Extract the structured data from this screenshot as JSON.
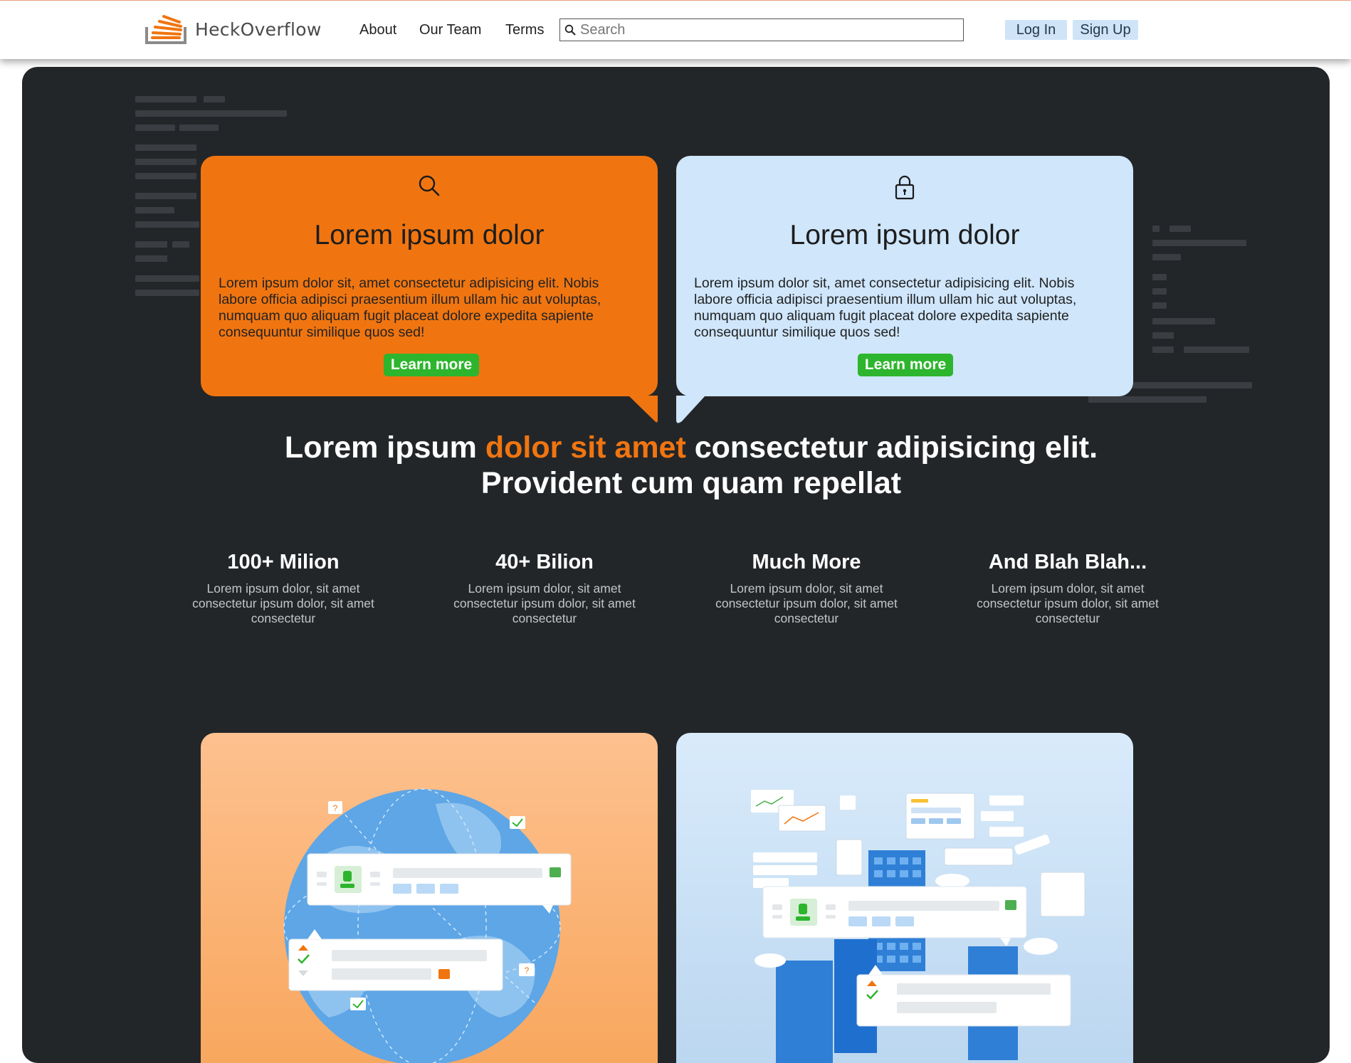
{
  "header": {
    "logo_text": "HeckOverflow",
    "nav": [
      "About",
      "Our Team",
      "Terms"
    ],
    "search": {
      "placeholder": "Search",
      "value": ""
    },
    "login_label": "Log In",
    "signup_label": "Sign Up"
  },
  "cards": [
    {
      "icon": "search-icon",
      "title": "Lorem ipsum dolor",
      "text": "Lorem ipsum dolor sit, amet consectetur adipisicing elit. Nobis labore officia adipisci praesentium illum ullam hic aut voluptas, numquam quo aliquam fugit placeat dolore expedita sapiente consequuntur similique quos sed!",
      "button": "Learn more"
    },
    {
      "icon": "lock-icon",
      "title": "Lorem ipsum dolor",
      "text": "Lorem ipsum dolor sit, amet consectetur adipisicing elit. Nobis labore officia adipisci praesentium illum ullam hic aut voluptas, numquam quo aliquam fugit placeat dolore expedita sapiente consequuntur similique quos sed!",
      "button": "Learn more"
    }
  ],
  "headline": {
    "part1": "Lorem ipsum ",
    "accent": "dolor sit amet",
    "part2": " consectetur adipisicing elit. Provident cum quam repellat"
  },
  "stats": [
    {
      "title": "100+ Milion",
      "text": "Lorem ipsum dolor, sit amet consectetur ipsum dolor, sit amet consectetur"
    },
    {
      "title": "40+ Bilion",
      "text": "Lorem ipsum dolor, sit amet consectetur ipsum dolor, sit amet consectetur"
    },
    {
      "title": "Much More",
      "text": "Lorem ipsum dolor, sit amet consectetur ipsum dolor, sit amet consectetur"
    },
    {
      "title": "And Blah Blah...",
      "text": "Lorem ipsum dolor, sit amet consectetur ipsum dolor, sit amet consectetur"
    }
  ],
  "colors": {
    "brand_orange": "#f07510",
    "card_blue": "#cfe6fb",
    "button_green": "#2db52d",
    "hero_bg": "#232629",
    "auth_button_bg": "#cfe4f7"
  }
}
